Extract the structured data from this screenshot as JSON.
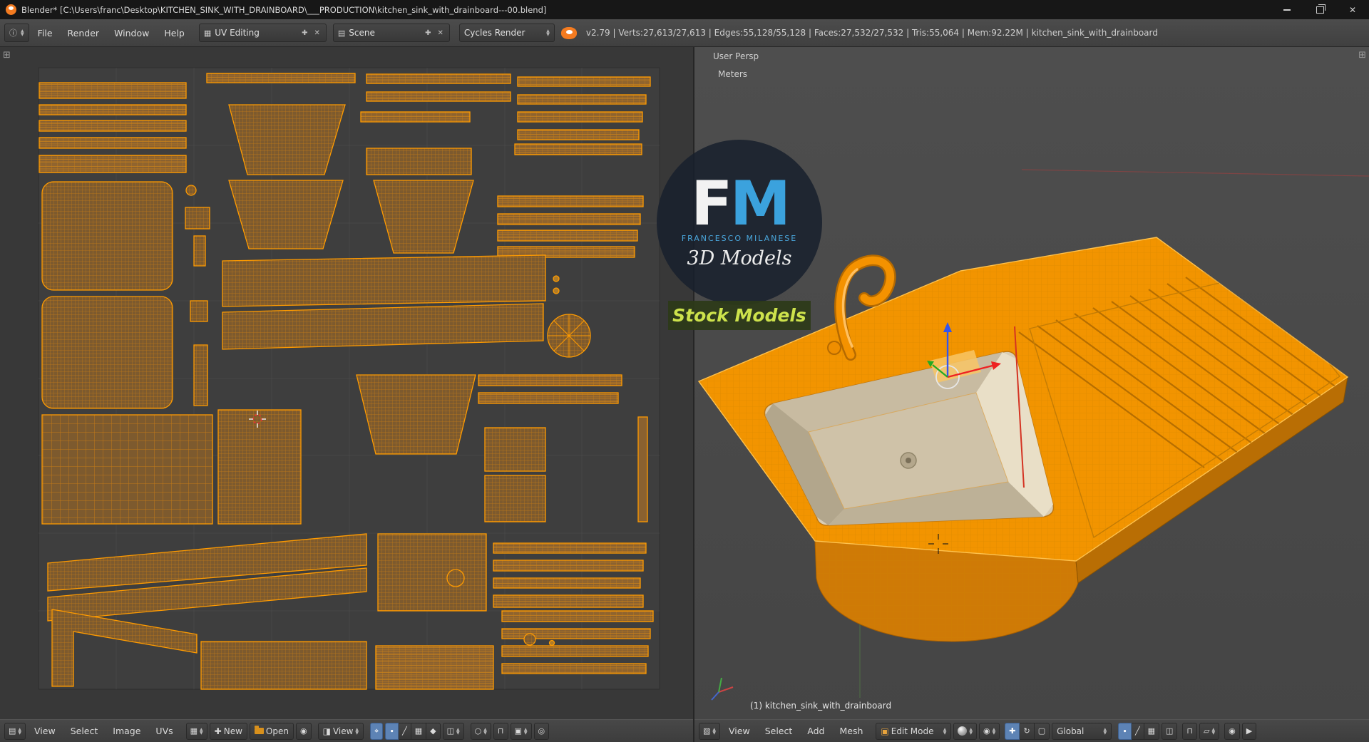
{
  "colors": {
    "accent": "#ff9b00",
    "uv-island-fill": "#7d5a2e",
    "titlebar-bg": "#171717",
    "header-bg": "#454545",
    "uv-bg": "#383838",
    "view3d-bg": "#4b4b4b",
    "pressed-blue": "#5d83b5",
    "logo-blue": "#3ba2dd",
    "banner-green": "#2c3a18",
    "banner-text": "#cde24c",
    "basin-cream": "#d9cdb4"
  },
  "titlebar": {
    "title": "Blender* [C:\\Users\\franc\\Desktop\\KITCHEN_SINK_WITH_DRAINBOARD\\___PRODUCTION\\kitchen_sink_with_drainboard---00.blend]"
  },
  "topbar": {
    "menus": [
      "File",
      "Render",
      "Window",
      "Help"
    ],
    "layout": "UV Editing",
    "scene": "Scene",
    "engine": "Cycles Render",
    "stats": "v2.79 | Verts:27,613/27,613 | Edges:55,128/55,128 | Faces:27,532/27,532 | Tris:55,064 | Mem:92.22M | kitchen_sink_with_drainboard"
  },
  "uv_header": {
    "menus": [
      "View",
      "Select",
      "Image",
      "UVs"
    ],
    "new_label": "New",
    "open_label": "Open",
    "view_mode": "View"
  },
  "view3d_header": {
    "menus": [
      "View",
      "Select",
      "Add",
      "Mesh"
    ],
    "mode": "Edit Mode",
    "orientation": "Global"
  },
  "view3d": {
    "view_label": "User Persp",
    "units_label": "Meters",
    "object_info": "(1) kitchen_sink_with_drainboard"
  },
  "logo": {
    "f": "F",
    "m": "M",
    "name": "FRANCESCO MILANESE",
    "products": "3D Models",
    "banner": "Stock Models"
  }
}
